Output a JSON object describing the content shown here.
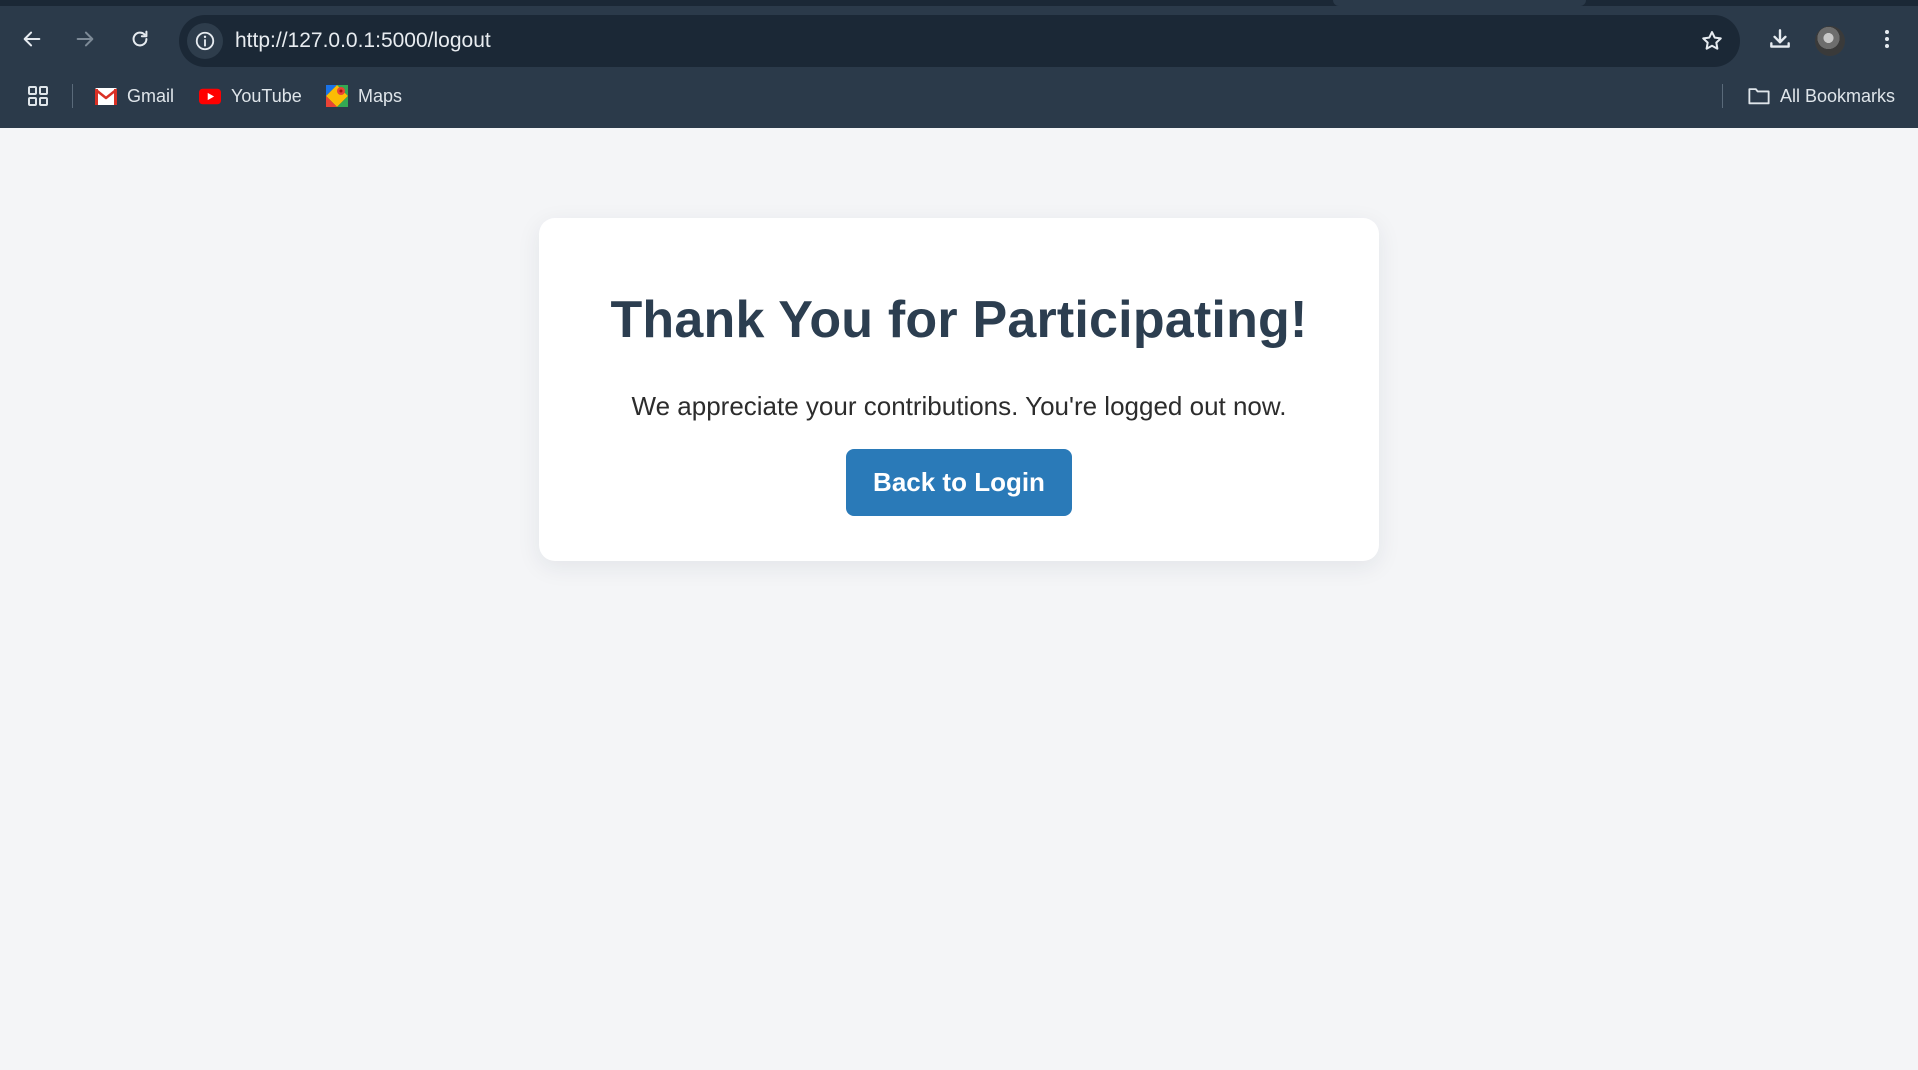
{
  "browser": {
    "url": "http://127.0.0.1:5000/logout",
    "bookmarks": [
      {
        "label": "Gmail",
        "icon": "gmail-icon"
      },
      {
        "label": "YouTube",
        "icon": "youtube-icon"
      },
      {
        "label": "Maps",
        "icon": "maps-icon"
      }
    ],
    "all_bookmarks_label": "All Bookmarks",
    "colors": {
      "chrome_bg": "#2b3a4a",
      "omnibox_bg": "#1b2836"
    }
  },
  "page": {
    "title": "Thank You for Participating!",
    "message": "We appreciate your contributions. You're logged out now.",
    "button_label": "Back to Login",
    "colors": {
      "background": "#f4f5f7",
      "title": "#2c3e50",
      "button": "#2a7ab8"
    }
  }
}
